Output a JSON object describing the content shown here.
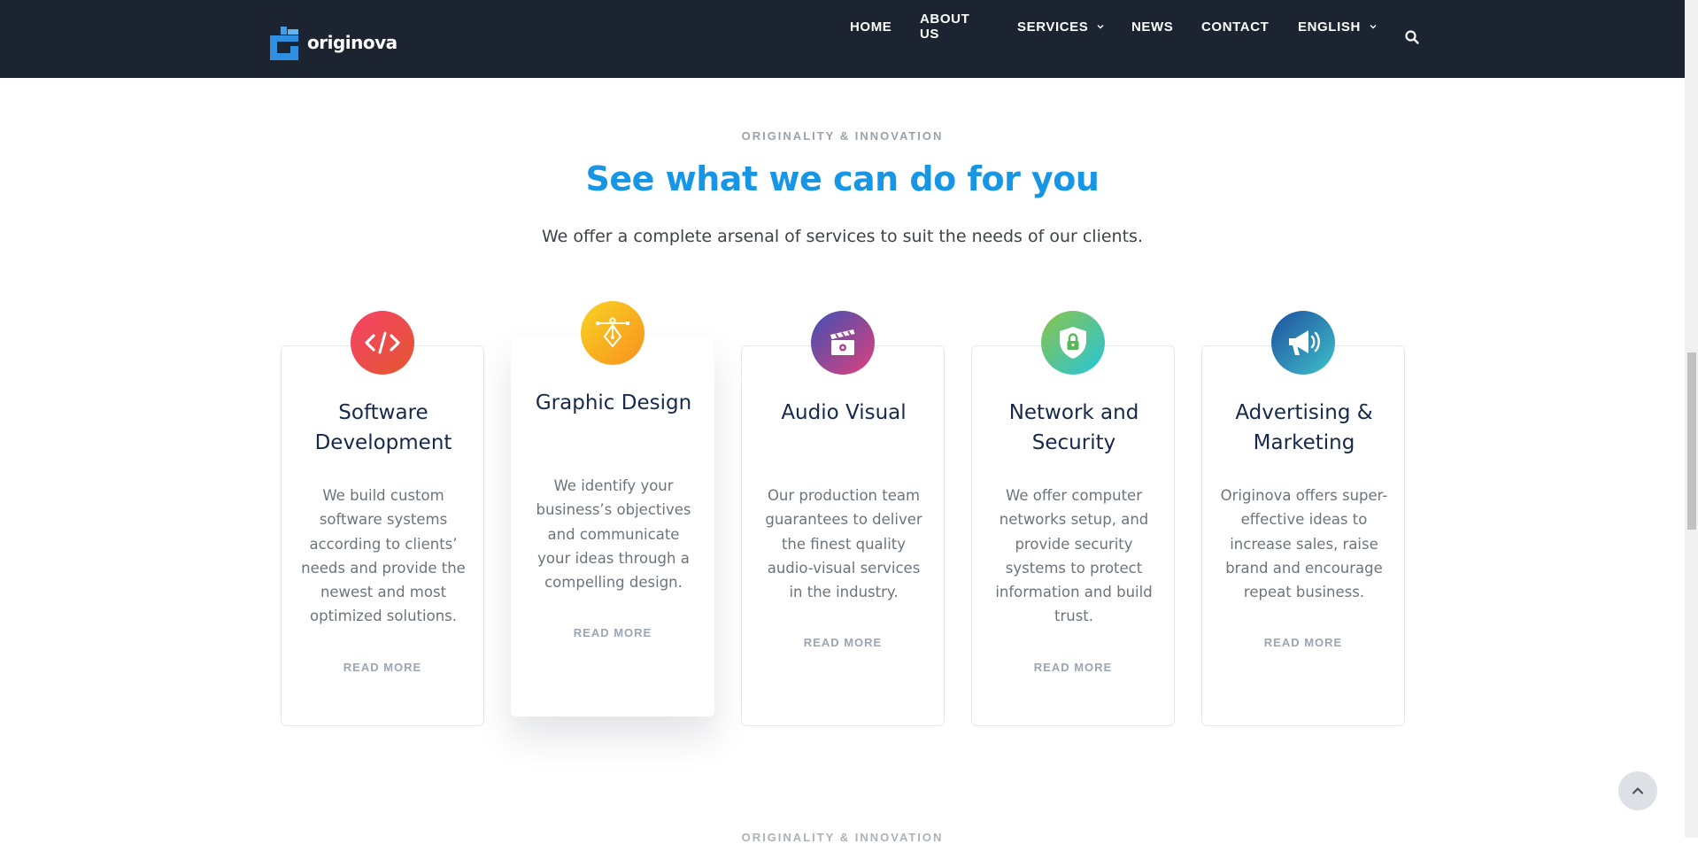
{
  "brand": {
    "name": "originova",
    "logo_color": "#2f8fe0"
  },
  "nav": {
    "items": [
      {
        "label": "HOME",
        "has_dropdown": false
      },
      {
        "label": "ABOUT US",
        "has_dropdown": false
      },
      {
        "label": "SERVICES",
        "has_dropdown": true
      },
      {
        "label": "NEWS",
        "has_dropdown": false
      },
      {
        "label": "CONTACT",
        "has_dropdown": false
      },
      {
        "label": "ENGLISH",
        "has_dropdown": true
      }
    ],
    "search_icon": "search-icon"
  },
  "intro": {
    "eyebrow": "ORIGINALITY & INNOVATION",
    "headline": "See what we can do for you",
    "subline": "We offer a complete arsenal of services to suit the needs of our clients."
  },
  "services": [
    {
      "title": "Software Development",
      "description": "We build custom software systems according to clients’ needs and provide the newest and most optimized solutions.",
      "read_more": "READ MORE",
      "icon": "code-icon",
      "gradient": [
        "#f7436a",
        "#e25a2b"
      ]
    },
    {
      "title": "Graphic Design",
      "description": "We identify your business’s objectives and communicate your ideas through a compelling design.",
      "read_more": "READ MORE",
      "icon": "pen-tool-icon",
      "gradient": [
        "#f9d423",
        "#f7931e"
      ]
    },
    {
      "title": "Audio Visual",
      "description": "Our production team guarantees to deliver the finest quality audio-visual services in the industry.",
      "read_more": "READ MORE",
      "icon": "clapperboard-icon",
      "gradient": [
        "#3f51b5",
        "#e0407b"
      ]
    },
    {
      "title": "Network and Security",
      "description": "We offer computer networks setup, and provide security systems to protect information and build trust.",
      "read_more": "READ MORE",
      "icon": "shield-lock-icon",
      "gradient": [
        "#8bc34a",
        "#26c6da"
      ]
    },
    {
      "title": "Advertising & Marketing",
      "description": "Originova offers super-effective ideas to increase sales, raise brand and encourage repeat business.",
      "read_more": "READ MORE",
      "icon": "megaphone-icon",
      "gradient": [
        "#1e5ea8",
        "#3ec1c9"
      ]
    }
  ],
  "bottom": {
    "eyebrow": "ORIGINALITY & INNOVATION"
  },
  "back_to_top_icon": "chevron-up-icon"
}
